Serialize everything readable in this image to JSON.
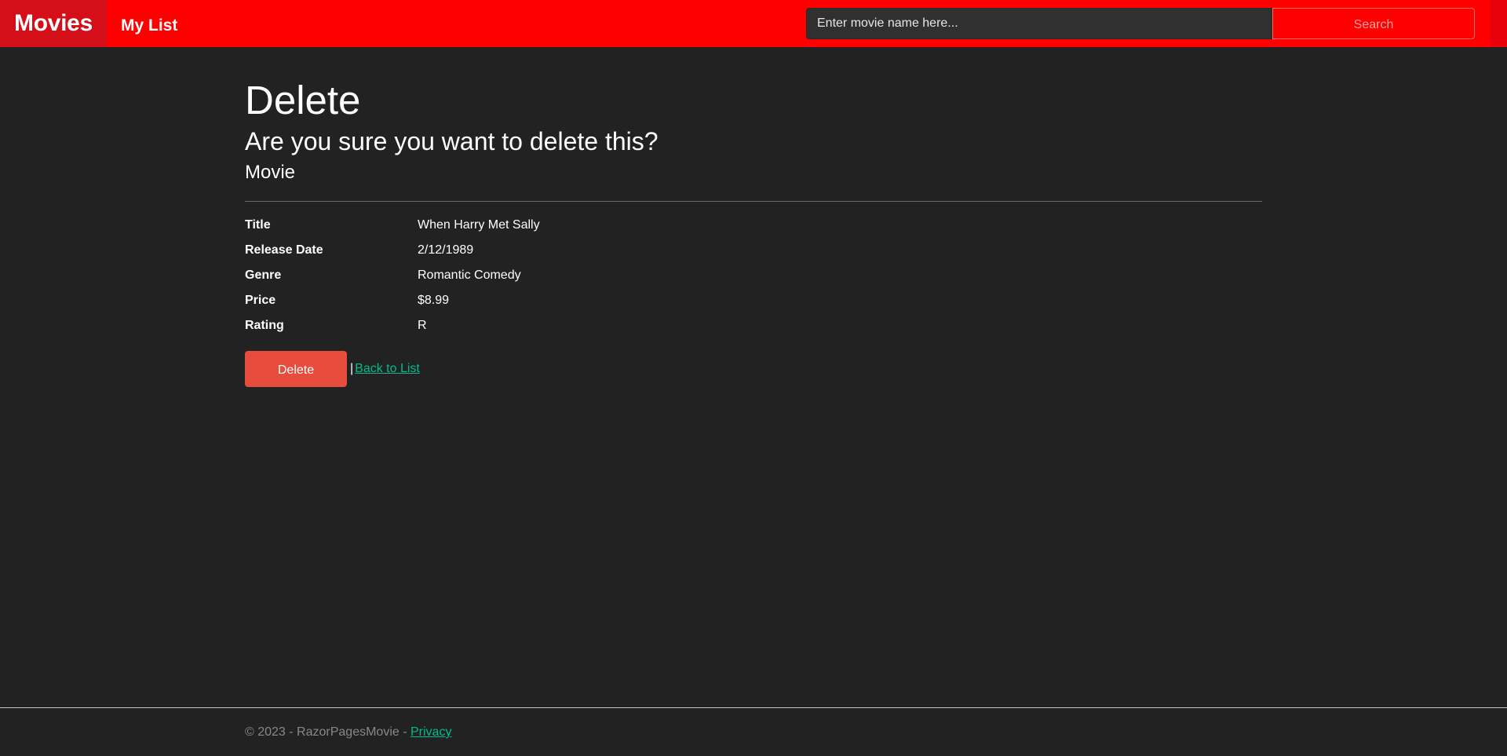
{
  "navbar": {
    "brand": "Movies",
    "my_list": "My List",
    "search": {
      "placeholder": "Enter movie name here...",
      "button_label": "Search"
    }
  },
  "page": {
    "title": "Delete",
    "confirm": "Are you sure you want to delete this?",
    "entity": "Movie"
  },
  "details": [
    {
      "label": "Title",
      "value": "When Harry Met Sally"
    },
    {
      "label": "Release Date",
      "value": "2/12/1989"
    },
    {
      "label": "Genre",
      "value": "Romantic Comedy"
    },
    {
      "label": "Price",
      "value": "$8.99"
    },
    {
      "label": "Rating",
      "value": "R"
    }
  ],
  "actions": {
    "delete_label": "Delete",
    "separator": "|",
    "back_label": "Back to List"
  },
  "footer": {
    "text": "© 2023 - RazorPagesMovie - ",
    "privacy": "Privacy"
  },
  "colors": {
    "navbar": "#ff0000",
    "brand_bg": "#d40f1a",
    "background": "#222222",
    "delete_button": "#e74c3c",
    "link": "#00bc8c"
  }
}
